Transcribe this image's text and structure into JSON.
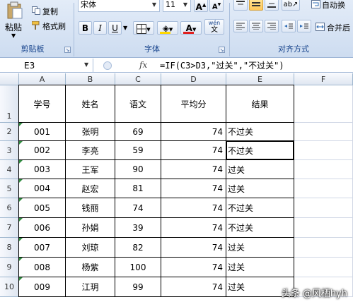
{
  "ribbon": {
    "clipboard": {
      "paste": "粘贴",
      "copy": "复制",
      "format_painter": "格式刷",
      "group_label": "剪贴板"
    },
    "font": {
      "font_name": "宋体",
      "font_size": "11",
      "group_label": "字体",
      "bold": "B",
      "italic": "I",
      "underline": "U",
      "grow": "A",
      "shrink": "A",
      "wen": "wén",
      "color_letter": "A"
    },
    "alignment": {
      "group_label": "对齐方式",
      "wrap": "自动换",
      "merge": "合并后"
    },
    "colors": {
      "accent": "#15428b",
      "font_color": "#e01f1f",
      "fill_color": "#ffd800"
    }
  },
  "formula_bar": {
    "name_box": "E3",
    "fx": "fx",
    "formula": "=IF(C3>D3,\"过关\",\"不过关\")"
  },
  "columns": [
    "A",
    "B",
    "C",
    "D",
    "E",
    "F"
  ],
  "rows": [
    "1",
    "2",
    "3",
    "4",
    "5",
    "6",
    "7",
    "8",
    "9",
    "10"
  ],
  "table": {
    "headers": [
      "学号",
      "姓名",
      "语文",
      "平均分",
      "结果"
    ],
    "data": [
      [
        "001",
        "张明",
        "69",
        "74",
        "不过关"
      ],
      [
        "002",
        "李亮",
        "59",
        "74",
        "不过关"
      ],
      [
        "003",
        "王军",
        "90",
        "74",
        "过关"
      ],
      [
        "004",
        "赵宏",
        "81",
        "74",
        "过关"
      ],
      [
        "005",
        "钱丽",
        "74",
        "74",
        "不过关"
      ],
      [
        "006",
        "孙娟",
        "39",
        "74",
        "不过关"
      ],
      [
        "007",
        "刘琼",
        "82",
        "74",
        "过关"
      ],
      [
        "008",
        "杨紫",
        "100",
        "74",
        "过关"
      ],
      [
        "009",
        "江玥",
        "99",
        "74",
        "过关"
      ]
    ]
  },
  "watermark": "头条 @风栖hyh"
}
